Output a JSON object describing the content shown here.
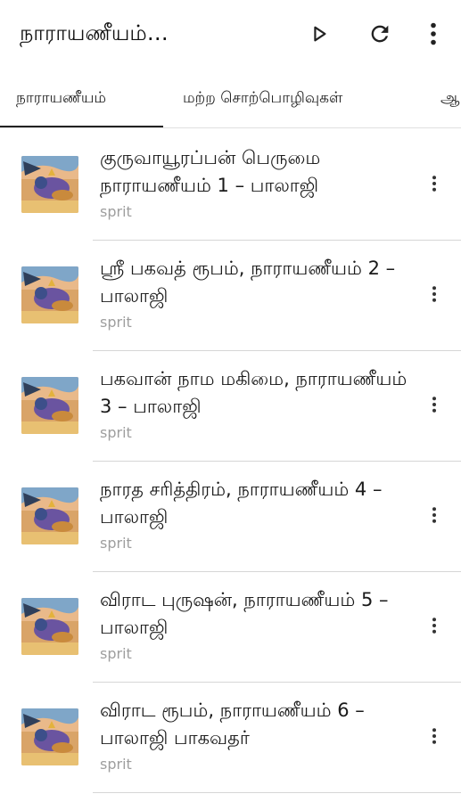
{
  "appbar": {
    "title": "நாராயணீயம்…",
    "actions": [
      {
        "icon": "play-icon"
      },
      {
        "icon": "refresh-icon"
      },
      {
        "icon": "more-vertical-icon"
      }
    ]
  },
  "tabs": [
    {
      "label": "நாராயணீயம்",
      "selected": true
    },
    {
      "label": "மற்ற சொற்பொழிவுகள்",
      "selected": false
    },
    {
      "label": "ஆ",
      "selected": false
    }
  ],
  "items": [
    {
      "title": "குருவாயூரப்பன் பெருமை நாராயணீயம் 1 – பாலாஜி",
      "subtitle": "sprit"
    },
    {
      "title": "ஸ்ரீ பகவத் ரூபம், நாராயணீயம் 2 – பாலாஜி",
      "subtitle": "sprit"
    },
    {
      "title": "பகவான் நாம மகிமை, நாராயணீயம் 3 – பாலாஜி",
      "subtitle": "sprit"
    },
    {
      "title": "நாரத சரித்திரம், நாராயணீயம் 4 – பாலாஜி",
      "subtitle": "sprit"
    },
    {
      "title": "விராட புருஷன், நாராயணீயம் 5 – பாலாஜி",
      "subtitle": "sprit"
    },
    {
      "title": "விராட ரூபம், நாராயணீயம் 6 – பாலாஜி பாகவதர்",
      "subtitle": "sprit"
    }
  ],
  "colors": {
    "text_primary": "#1a1a1a",
    "text_secondary": "#9e9e9e",
    "divider": "#d6d6d6",
    "tab_indicator": "#222222"
  }
}
